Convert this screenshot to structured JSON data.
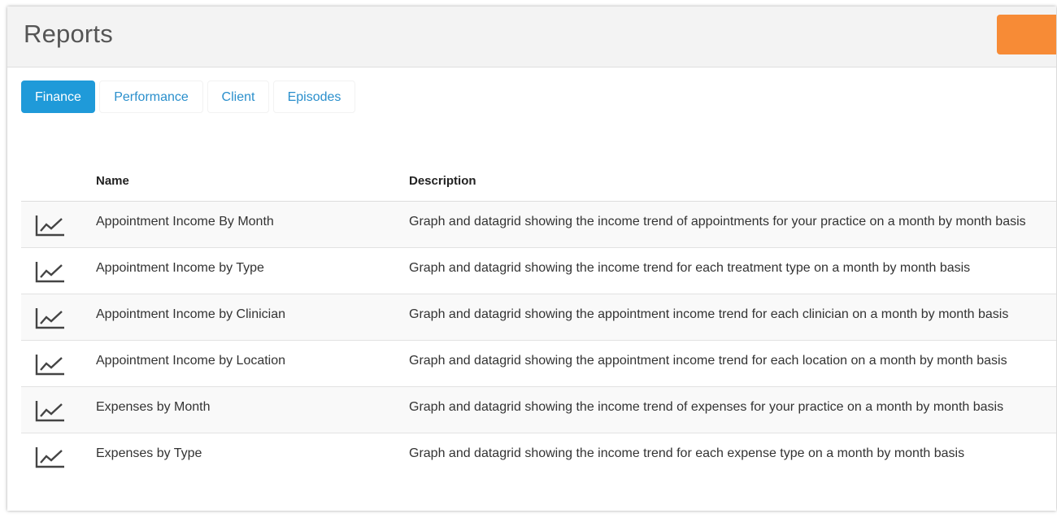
{
  "header": {
    "title": "Reports",
    "action_color": "#f78b36"
  },
  "tabs": [
    {
      "label": "Finance",
      "active": true
    },
    {
      "label": "Performance",
      "active": false
    },
    {
      "label": "Client",
      "active": false
    },
    {
      "label": "Episodes",
      "active": false
    }
  ],
  "table": {
    "columns": {
      "name": "Name",
      "description": "Description"
    },
    "rows": [
      {
        "icon": "line-chart-icon",
        "name": "Appointment Income By Month",
        "description": "Graph and datagrid showing the income trend of appointments for your practice on a month by month basis"
      },
      {
        "icon": "line-chart-icon",
        "name": "Appointment Income by Type",
        "description": "Graph and datagrid showing the income trend for each treatment type on a month by month basis"
      },
      {
        "icon": "line-chart-icon",
        "name": "Appointment Income by Clinician",
        "description": "Graph and datagrid showing the appointment income trend for each clinician on a month by month basis"
      },
      {
        "icon": "line-chart-icon",
        "name": "Appointment Income by Location",
        "description": "Graph and datagrid showing the appointment income trend for each location on a month by month basis"
      },
      {
        "icon": "line-chart-icon",
        "name": "Expenses by Month",
        "description": "Graph and datagrid showing the income trend of expenses for your practice on a month by month basis"
      },
      {
        "icon": "line-chart-icon",
        "name": "Expenses by Type",
        "description": "Graph and datagrid showing the income trend for each expense type on a month by month basis"
      }
    ]
  },
  "colors": {
    "accent": "#1f9ad9",
    "link": "#2a8fcc",
    "header_bg": "#f3f3f3"
  }
}
